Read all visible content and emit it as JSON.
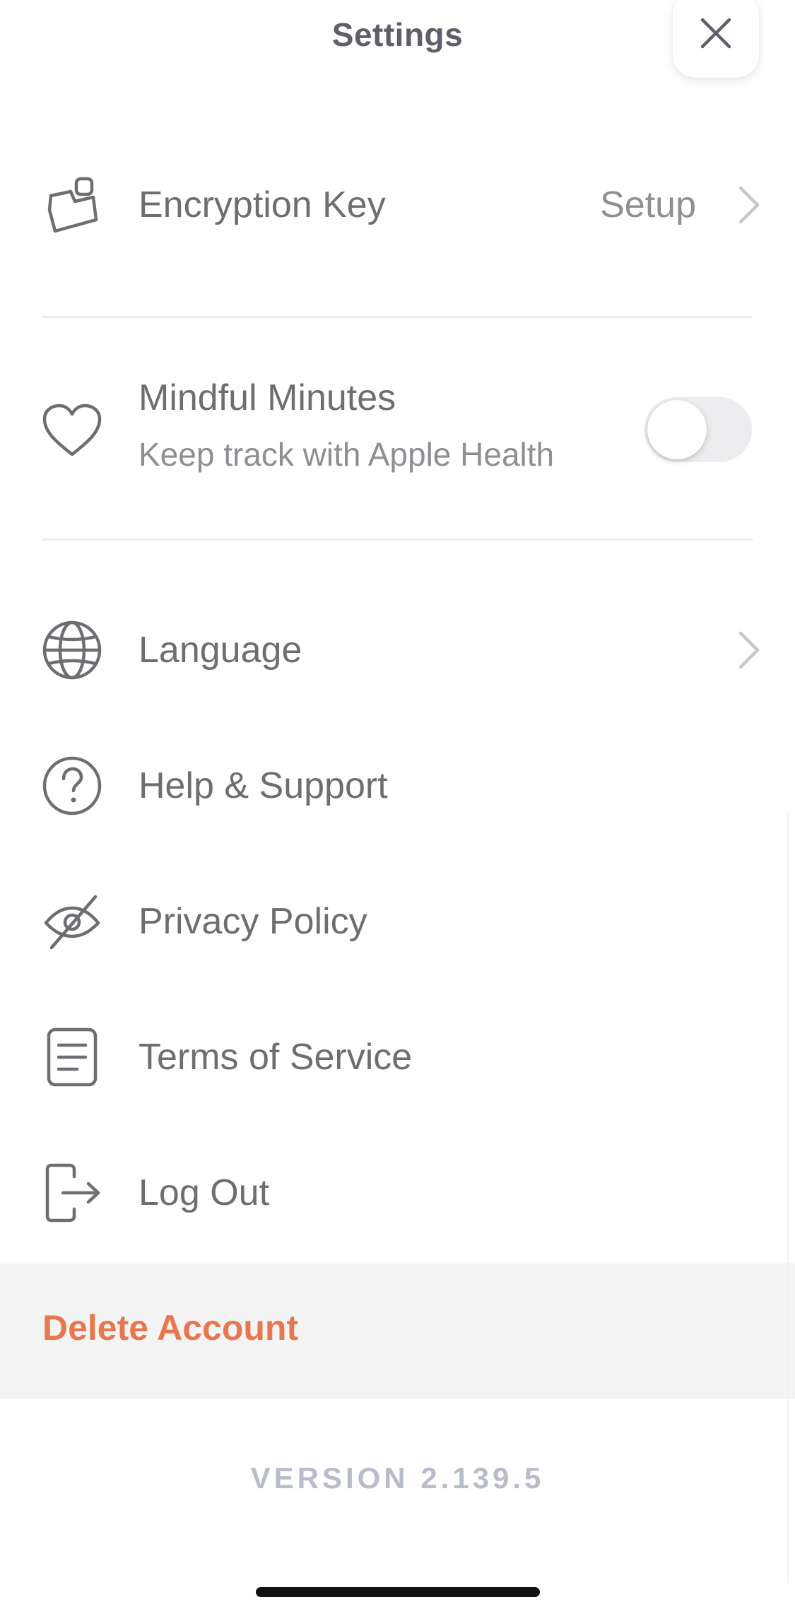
{
  "header": {
    "title": "Settings",
    "close_icon": "close-icon"
  },
  "items": {
    "encryption": {
      "label": "Encryption Key",
      "value": "Setup",
      "icon": "key-card-icon"
    },
    "mindful": {
      "label": "Mindful Minutes",
      "sublabel": "Keep track with Apple Health",
      "toggle_on": false,
      "icon": "heart-icon"
    },
    "language": {
      "label": "Language",
      "icon": "globe-icon"
    },
    "help": {
      "label": "Help & Support",
      "icon": "help-circle-icon"
    },
    "privacy": {
      "label": "Privacy Policy",
      "icon": "eye-off-icon"
    },
    "terms": {
      "label": "Terms of Service",
      "icon": "document-icon"
    },
    "logout": {
      "label": "Log Out",
      "icon": "logout-icon"
    }
  },
  "delete_account": {
    "label": "Delete Account"
  },
  "footer": {
    "version": "VERSION 2.139.5"
  },
  "colors": {
    "title": "#5f5f6c",
    "text": "#6e6e72",
    "subtext": "#8e8e93",
    "danger": "#e8774f",
    "version": "#b8bccb"
  }
}
